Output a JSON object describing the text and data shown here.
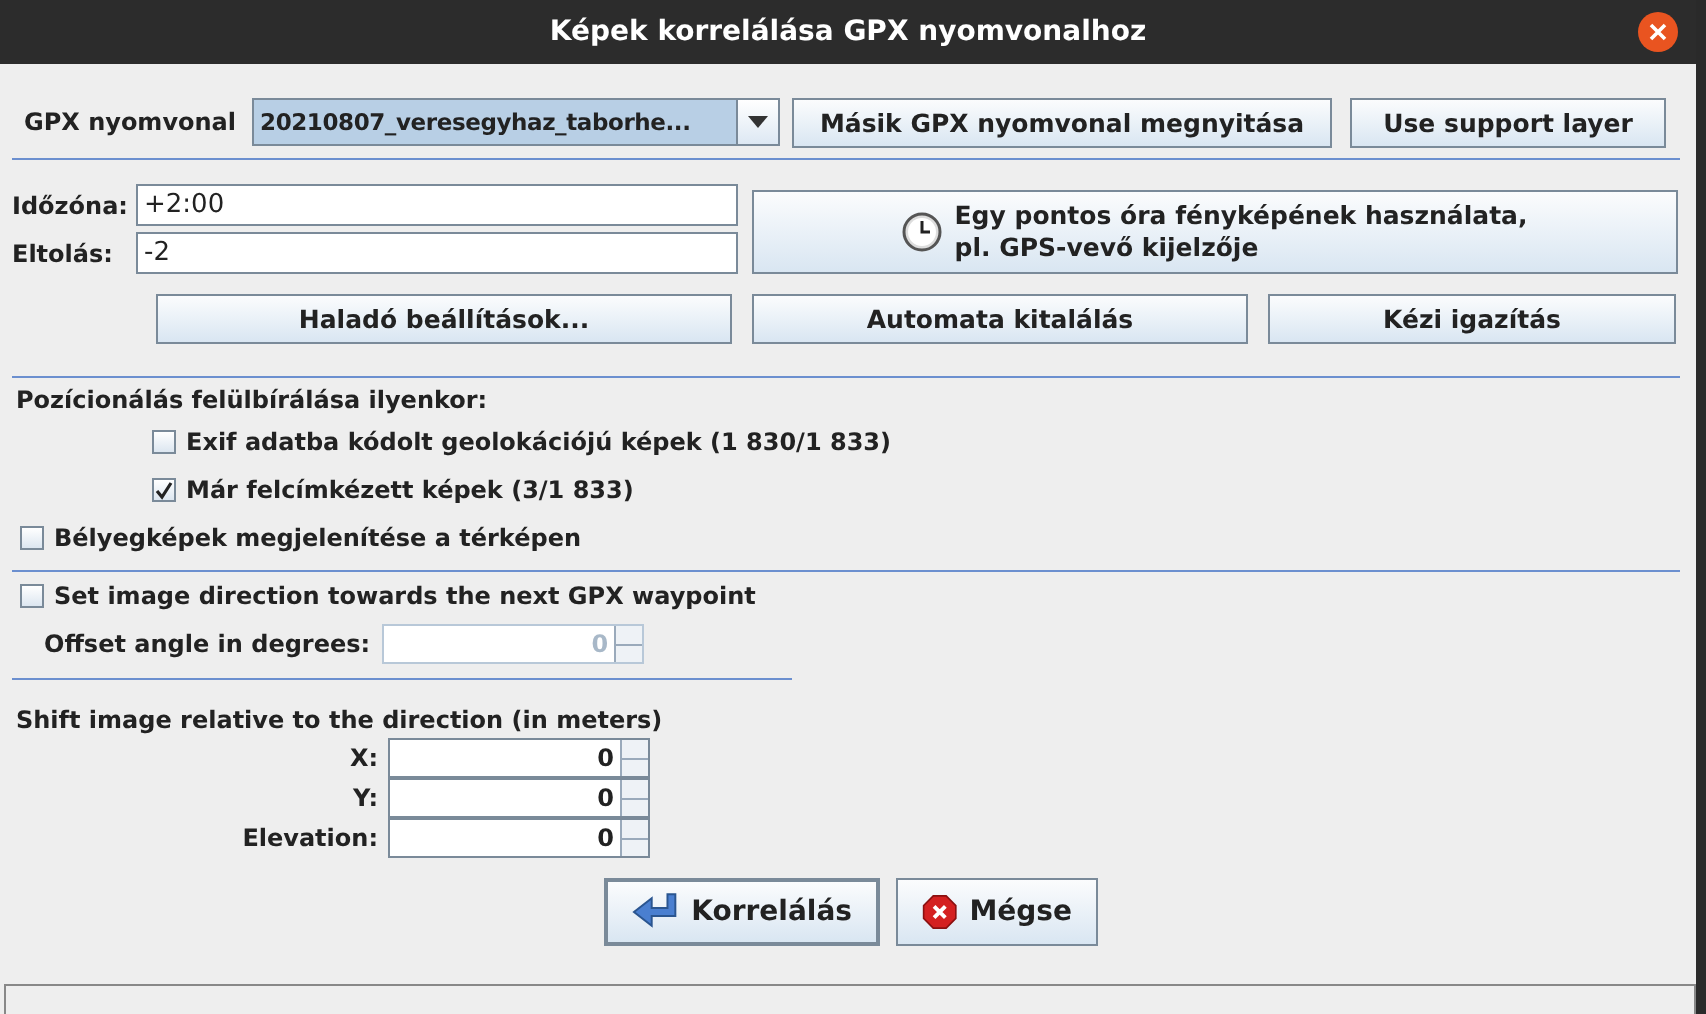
{
  "window": {
    "title": "Képek korrelálása GPX nyomvonalhoz"
  },
  "gpx": {
    "label": "GPX nyomvonal",
    "value": "20210807_veresegyhaz_taborhe...",
    "buttons": [
      "Másik GPX nyomvonal megnyitása",
      "Use support layer"
    ]
  },
  "fields": [
    {
      "label": "Időzóna:",
      "value": "+2:00"
    },
    {
      "label": "Eltolás:",
      "value": "-2"
    }
  ],
  "clock_button": "Egy pontos óra fényképének használata,\npl. GPS-vevő kijelzője",
  "sync_buttons": [
    "Haladó beállítások...",
    "Automata kitalálás",
    "Kézi igazítás"
  ],
  "override": {
    "heading": "Pozícionálás felülbírálása ilyenkor:",
    "options": [
      {
        "label": "Exif adatba kódolt geolokációjú képek (1 830/1 833)",
        "checked": false
      },
      {
        "label": "Már felcímkézett képek (3/1 833)",
        "checked": true
      }
    ]
  },
  "thumbnails": {
    "label": "Bélyegképek megjelenítése a térképen",
    "checked": false
  },
  "direction": {
    "label": "Set image direction towards the next GPX waypoint",
    "checked": false,
    "offset": {
      "label": "Offset angle in degrees:",
      "value": "0",
      "disabled": true
    }
  },
  "shift": {
    "heading": "Shift image relative to the direction (in meters)",
    "spinners": [
      {
        "label": "X:",
        "value": "0",
        "disabled": false
      },
      {
        "label": "Y:",
        "value": "0",
        "disabled": false
      },
      {
        "label": "Elevation:",
        "value": "0",
        "disabled": false
      }
    ]
  },
  "actions": [
    {
      "kind": "ok",
      "label": "Korrelálás"
    },
    {
      "kind": "cancel",
      "label": "Mégse"
    }
  ]
}
